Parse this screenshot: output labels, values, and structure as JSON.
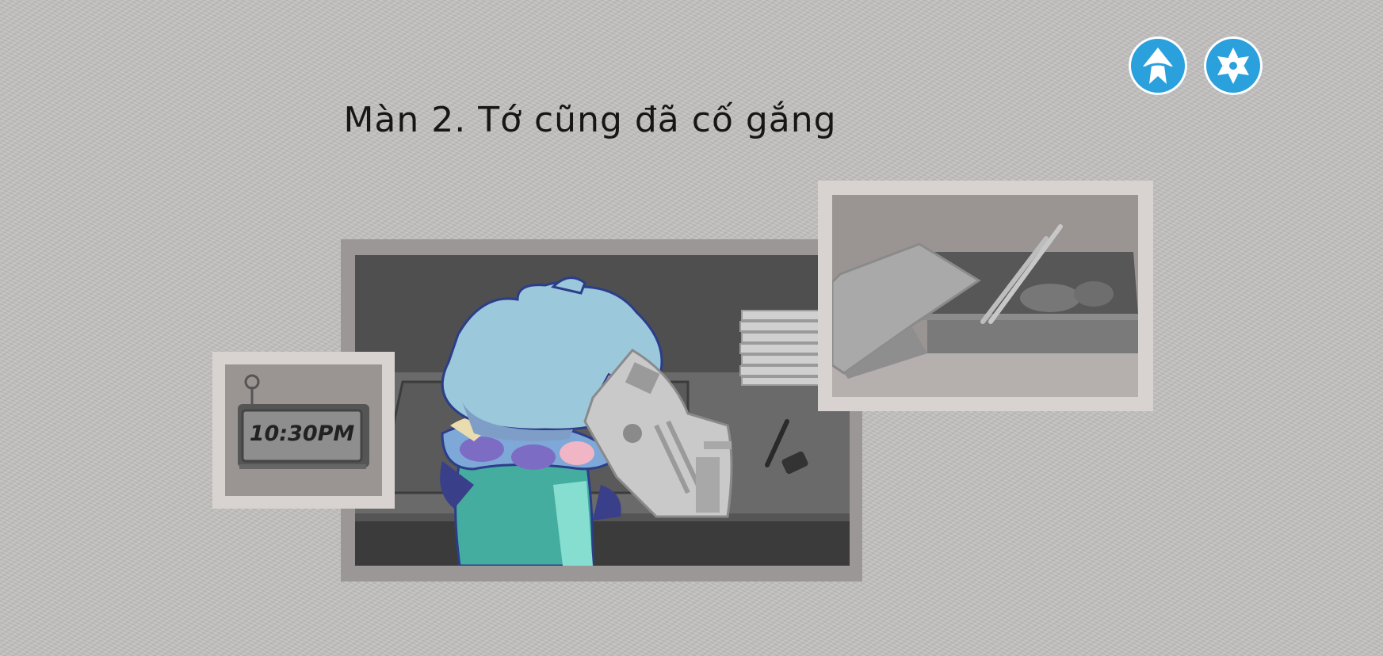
{
  "level": {
    "title": "Màn 2. Tớ cũng đã cố gắng"
  },
  "controls": {
    "home_icon": "home-icon",
    "settings_icon": "gear-icon",
    "accent": "#2aa0dc"
  },
  "scenes": {
    "clock_text": "10:30PM"
  }
}
